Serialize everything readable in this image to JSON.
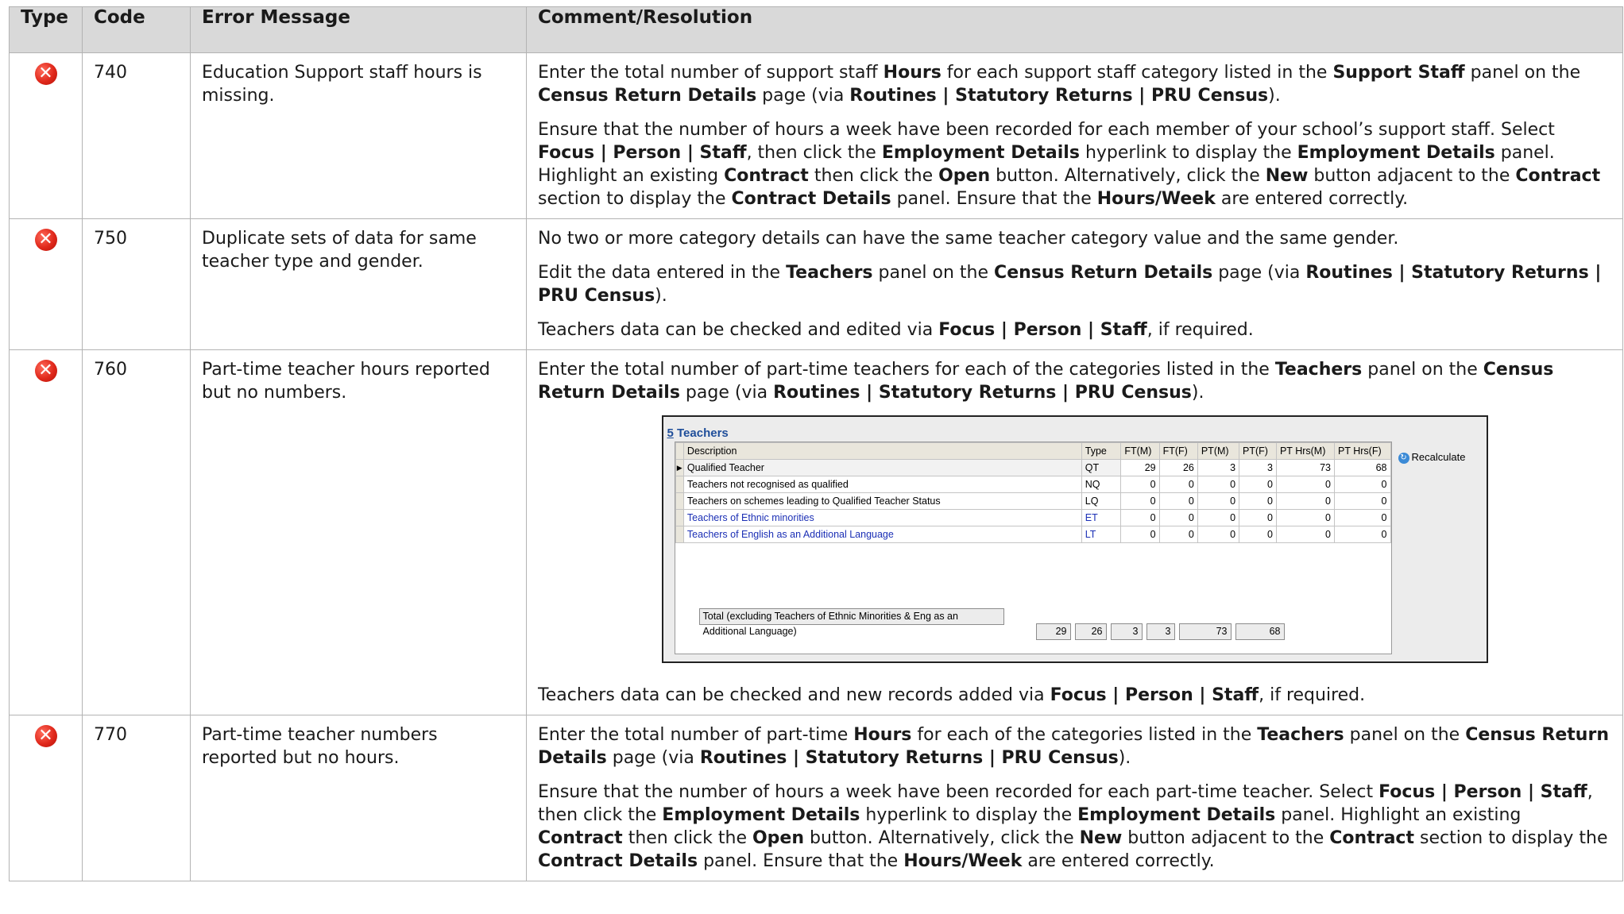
{
  "headers": {
    "type": "Type",
    "code": "Code",
    "message": "Error Message",
    "comment": "Comment/Resolution"
  },
  "rows": [
    {
      "icon": "error-icon",
      "code": "740",
      "message": "Education Support staff hours is missing.",
      "paras": [
        [
          {
            "t": "Enter the total number of support staff "
          },
          {
            "t": "Hours",
            "b": true
          },
          {
            "t": " for each support staff category listed in the "
          },
          {
            "t": "Support Staff",
            "b": true
          },
          {
            "t": " panel on the "
          },
          {
            "t": "Census Return Details",
            "b": true
          },
          {
            "t": " page (via "
          },
          {
            "t": "Routines | Statutory Returns | PRU Census",
            "b": true
          },
          {
            "t": ")."
          }
        ],
        [
          {
            "t": "Ensure that the number of hours a week have been recorded for each member of your school’s support staff. Select "
          },
          {
            "t": "Focus | Person | Staff",
            "b": true
          },
          {
            "t": ", then click the "
          },
          {
            "t": "Employment Details",
            "b": true
          },
          {
            "t": " hyperlink to display the "
          },
          {
            "t": "Employment Details",
            "b": true
          },
          {
            "t": " panel. Highlight an existing "
          },
          {
            "t": "Contract",
            "b": true
          },
          {
            "t": " then click the "
          },
          {
            "t": "Open",
            "b": true
          },
          {
            "t": " button. Alternatively, click the "
          },
          {
            "t": "New",
            "b": true
          },
          {
            "t": " button adjacent to the "
          },
          {
            "t": "Contract",
            "b": true
          },
          {
            "t": " section to display the "
          },
          {
            "t": "Contract Details",
            "b": true
          },
          {
            "t": " panel. Ensure that the "
          },
          {
            "t": "Hours/Week",
            "b": true
          },
          {
            "t": " are entered correctly."
          }
        ]
      ]
    },
    {
      "icon": "error-icon",
      "code": "750",
      "message": "Duplicate sets of data for same teacher type and gender.",
      "paras": [
        [
          {
            "t": "No two or more category details can have the same teacher category value and the same gender."
          }
        ],
        [
          {
            "t": "Edit the data entered in the "
          },
          {
            "t": "Teachers",
            "b": true
          },
          {
            "t": " panel on the "
          },
          {
            "t": "Census Return Details",
            "b": true
          },
          {
            "t": " page (via "
          },
          {
            "t": "Routines | Statutory Returns | PRU Census",
            "b": true
          },
          {
            "t": ")."
          }
        ],
        [
          {
            "t": "Teachers data can be checked and edited via "
          },
          {
            "t": "Focus | Person | Staff",
            "b": true
          },
          {
            "t": ", if required."
          }
        ]
      ]
    },
    {
      "icon": "error-icon",
      "code": "760",
      "message": "Part-time teacher hours reported but no numbers.",
      "paras": [
        [
          {
            "t": "Enter the total number of part-time teachers for each of the categories listed in the "
          },
          {
            "t": "Teachers",
            "b": true
          },
          {
            "t": " panel on the "
          },
          {
            "t": "Census Return Details",
            "b": true
          },
          {
            "t": " page (via "
          },
          {
            "t": "Routines | Statutory Returns | PRU Census",
            "b": true
          },
          {
            "t": ")."
          }
        ]
      ],
      "after_paras": [
        [
          {
            "t": "Teachers data can be checked and new records added via "
          },
          {
            "t": "Focus | Person | Staff",
            "b": true
          },
          {
            "t": ", if required."
          }
        ]
      ]
    },
    {
      "icon": "error-icon",
      "code": "770",
      "message": "Part-time teacher numbers reported but no hours.",
      "paras": [
        [
          {
            "t": "Enter the total number of part-time "
          },
          {
            "t": "Hours",
            "b": true
          },
          {
            "t": " for each of the categories listed in the "
          },
          {
            "t": "Teachers",
            "b": true
          },
          {
            "t": " panel on the "
          },
          {
            "t": "Census Return Details",
            "b": true
          },
          {
            "t": " page (via "
          },
          {
            "t": "Routines | Statutory Returns | PRU Census",
            "b": true
          },
          {
            "t": ")."
          }
        ],
        [
          {
            "t": "Ensure that the number of hours a week have been recorded for each part-time teacher. Select "
          },
          {
            "t": "Focus | Person | Staff",
            "b": true
          },
          {
            "t": ", then click the "
          },
          {
            "t": "Employment Details",
            "b": true
          },
          {
            "t": " hyperlink to display the "
          },
          {
            "t": "Employment Details",
            "b": true
          },
          {
            "t": " panel. Highlight an existing "
          },
          {
            "t": "Contract",
            "b": true
          },
          {
            "t": " then click the "
          },
          {
            "t": "Open",
            "b": true
          },
          {
            "t": " button. Alternatively, click the "
          },
          {
            "t": "New",
            "b": true
          },
          {
            "t": " button adjacent to the "
          },
          {
            "t": "Contract",
            "b": true
          },
          {
            "t": " section to display the "
          },
          {
            "t": "Contract Details",
            "b": true
          },
          {
            "t": " panel. Ensure that the "
          },
          {
            "t": "Hours/Week",
            "b": true
          },
          {
            "t": " are entered correctly."
          }
        ]
      ]
    }
  ],
  "teachers_panel": {
    "title_num": "5",
    "title": "Teachers",
    "recalculate": "Recalculate",
    "columns": [
      "Description",
      "Type",
      "FT(M)",
      "FT(F)",
      "PT(M)",
      "PT(F)",
      "PT Hrs(M)",
      "PT Hrs(F)"
    ],
    "rows": [
      {
        "desc": "Qualified Teacher",
        "type": "QT",
        "vals": [
          "29",
          "26",
          "3",
          "3",
          "73",
          "68"
        ],
        "blue": false,
        "selected": true
      },
      {
        "desc": "Teachers not recognised as qualified",
        "type": "NQ",
        "vals": [
          "0",
          "0",
          "0",
          "0",
          "0",
          "0"
        ],
        "blue": false
      },
      {
        "desc": "Teachers on schemes leading to Qualified Teacher Status",
        "type": "LQ",
        "vals": [
          "0",
          "0",
          "0",
          "0",
          "0",
          "0"
        ],
        "blue": false
      },
      {
        "desc": "Teachers of Ethnic minorities",
        "type": "ET",
        "vals": [
          "0",
          "0",
          "0",
          "0",
          "0",
          "0"
        ],
        "blue": true
      },
      {
        "desc": "Teachers of English as an Additional Language",
        "type": "LT",
        "vals": [
          "0",
          "0",
          "0",
          "0",
          "0",
          "0"
        ],
        "blue": true
      }
    ],
    "total_label": "Total (excluding Teachers of Ethnic Minorities & Eng as an Additional Language)",
    "total_vals": [
      "29",
      "26",
      "3",
      "3",
      "73",
      "68"
    ]
  }
}
